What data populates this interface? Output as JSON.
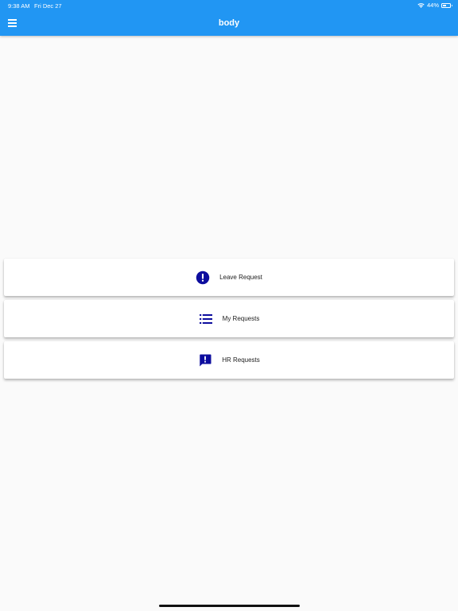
{
  "status_bar": {
    "time": "9:38 AM",
    "date": "Fri Dec 27",
    "battery": "44%",
    "battery_level": 0.44
  },
  "header": {
    "title": "body",
    "menu_icon": "menu-icon"
  },
  "menu_items": [
    {
      "label": "Leave Request",
      "icon": "exclamation-circle-icon"
    },
    {
      "label": "My Requests",
      "icon": "list-icon"
    },
    {
      "label": "HR Requests",
      "icon": "feedback-icon"
    }
  ],
  "colors": {
    "primary": "#2196f3",
    "icon": "#0d0d9e",
    "background": "#fafafa"
  }
}
